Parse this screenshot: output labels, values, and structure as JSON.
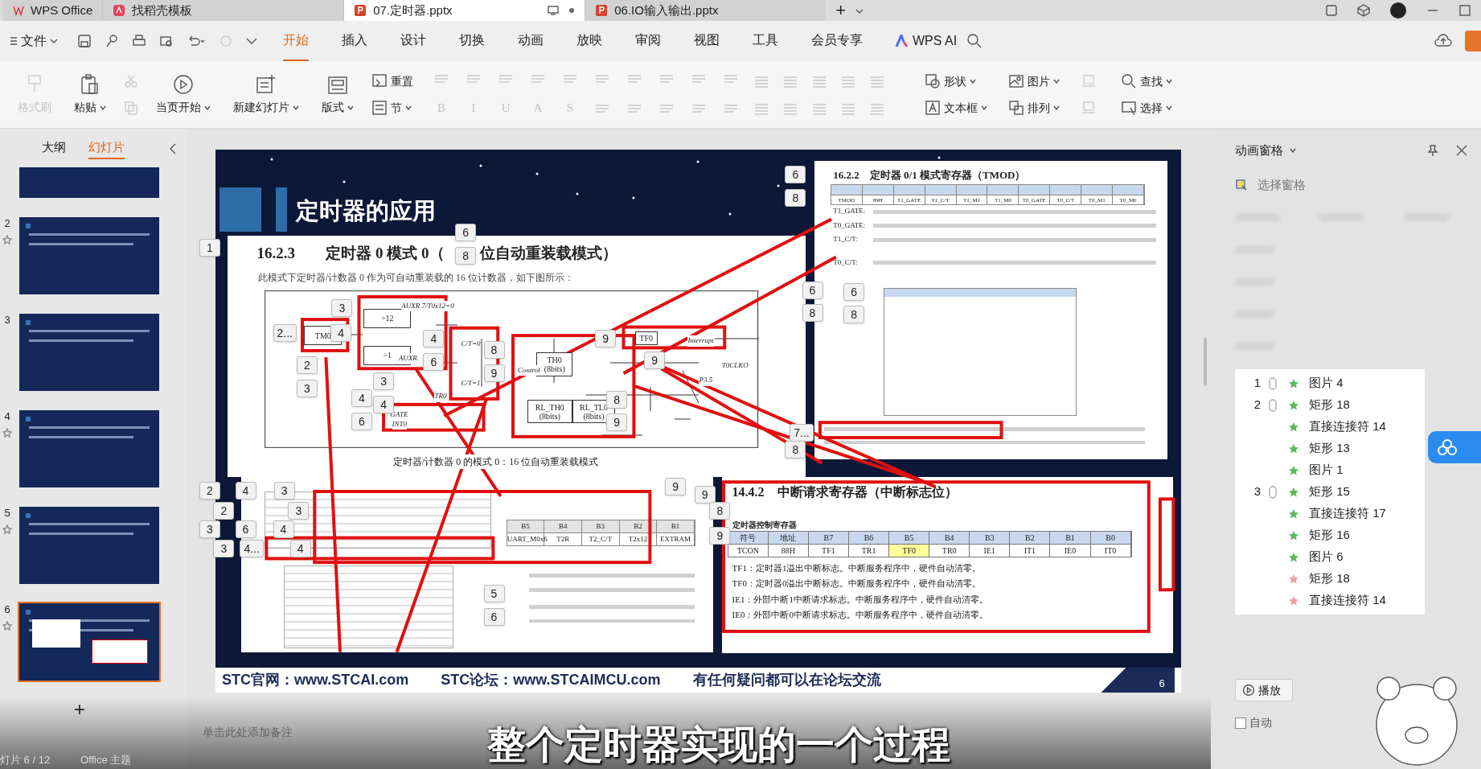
{
  "tabs": [
    {
      "label": "WPS Office",
      "kind": "home",
      "selected": false
    },
    {
      "label": "找稻壳模板",
      "kind": "template",
      "selected": false
    },
    {
      "label": "07.定时器.pptx",
      "kind": "doc",
      "selected": true
    },
    {
      "label": "06.IO输入输出.pptx",
      "kind": "doc",
      "selected": false
    }
  ],
  "new_tab": "+",
  "menu": {
    "file": "文件",
    "tabs": [
      {
        "label": "开始",
        "selected": true
      },
      {
        "label": "插入",
        "selected": false
      },
      {
        "label": "设计",
        "selected": false
      },
      {
        "label": "切换",
        "selected": false
      },
      {
        "label": "动画",
        "selected": false
      },
      {
        "label": "放映",
        "selected": false
      },
      {
        "label": "审阅",
        "selected": false
      },
      {
        "label": "视图",
        "selected": false
      },
      {
        "label": "工具",
        "selected": false
      },
      {
        "label": "会员专享",
        "selected": false
      }
    ],
    "ai": "WPS AI"
  },
  "ribbon": {
    "left": [
      {
        "label": "格式刷",
        "disabled": true
      },
      {
        "label": "粘贴",
        "disabled": false
      },
      {
        "label": "当页开始",
        "disabled": false
      },
      {
        "label": "新建幻灯片",
        "disabled": false
      },
      {
        "label": "版式",
        "disabled": false
      }
    ],
    "stack": [
      {
        "label": "重置"
      },
      {
        "label": "节"
      }
    ],
    "format": [
      "B",
      "I",
      "U",
      "A",
      "S"
    ],
    "right": [
      {
        "label": "形状"
      },
      {
        "label": "图片"
      },
      {
        "label": "查找"
      },
      {
        "label": "文本框"
      },
      {
        "label": "排列"
      },
      {
        "label": "选择"
      }
    ]
  },
  "side": {
    "tabs": [
      {
        "label": "大纲",
        "selected": false
      },
      {
        "label": "幻灯片",
        "selected": true
      }
    ],
    "slides": [
      {
        "animated": false,
        "selected": false
      },
      {
        "number": "2",
        "animated": true,
        "selected": false
      },
      {
        "number": "3",
        "animated": false,
        "selected": false
      },
      {
        "number": "4",
        "animated": true,
        "selected": false
      },
      {
        "number": "5",
        "animated": true,
        "selected": false
      },
      {
        "number": "6",
        "animated": true,
        "selected": true
      }
    ],
    "add": "+"
  },
  "slide": {
    "title": "定时器的应用",
    "doc1": {
      "heading": [
        "16.2.3",
        "定时器 0 模式 0（",
        "位自动重装载模式）"
      ],
      "intro": "此模式下定时器/计数器 0 作为可自动重装载的 16 位计数器，如下图所示：",
      "caption": "定时器/计数器 0 的模式 0：16 位自动重装载模式",
      "blocks": [
        "TM0",
        "÷12",
        "÷1",
        "TH0 (8bits)",
        "RL_TH0 (8bits)",
        "RL_TL0 (8bits)",
        "TF0"
      ],
      "labels": [
        "AUXR.7/T0x12=0",
        "AUXR.",
        "C/T=0",
        "C/T=1",
        "Interrupt",
        "T0CLKO",
        "P3.5",
        "TR0",
        "GATE",
        "INT0",
        "Control"
      ]
    },
    "doc2": {
      "heading": "16.2.2　定时器 0/1 模式寄存器（TMOD）",
      "row": [
        "TMOD",
        "89H",
        "T1_GATE",
        "T1_C/T",
        "T1_M1",
        "T1_M0",
        "T0_GATE",
        "T0_C/T",
        "T0_M1",
        "T0_M0"
      ],
      "fields": [
        "T1_GATE:",
        "T0_GATE:",
        "T1_C/T:",
        "T0_C/T:"
      ]
    },
    "doc3": {
      "heading": "14.4.2　中断请求寄存器（中断标志位）",
      "table_title": "定时器控制寄存器",
      "header": [
        "符号",
        "地址",
        "B7",
        "B6",
        "B5",
        "B4",
        "B3",
        "B2",
        "B1",
        "B0"
      ],
      "row": [
        "TCON",
        "88H",
        "TF1",
        "TR1",
        "TF0",
        "TR0",
        "IE1",
        "IT1",
        "IE0",
        "IT0"
      ],
      "notes": [
        "TF1：定时器1溢出中断标志。中断服务程序中，硬件自动清零。",
        "TF0：定时器0溢出中断标志。中断服务程序中，硬件自动清零。",
        "IE1：外部中断1中断请求标志。中断服务程序中，硬件自动清零。",
        "IE0：外部中断0中断请求标志。中断服务程序中，硬件自动清零。"
      ]
    },
    "doc4": {
      "header": [
        "B5",
        "B4",
        "B3",
        "B2",
        "B1"
      ],
      "row": [
        "UART_M0x6",
        "T2R",
        "T2_C/T",
        "T2x12",
        "EXTRAM"
      ]
    },
    "tags": [
      "1",
      "6",
      "8",
      "3",
      "2...",
      "4",
      "2",
      "3",
      "4",
      "6",
      "8",
      "9",
      "3",
      "4",
      "4",
      "6",
      "9",
      "9",
      "8",
      "9",
      "6",
      "8",
      "6",
      "8",
      "6",
      "8",
      "7...",
      "8",
      "9",
      "9",
      "8",
      "9",
      "5",
      "6",
      "2",
      "4",
      "3",
      "2",
      "3",
      "3",
      "6",
      "4",
      "3",
      "4...",
      "4"
    ],
    "footer": [
      "STC官网：www.STCAI.com",
      "STC论坛：www.STCAIMCU.com",
      "有任何疑问都可以在论坛交流"
    ],
    "page": "6"
  },
  "notes_placeholder": "单击此处添加备注",
  "subtitle": "整个定时器实现的一个过程",
  "status": {
    "slide_count": "灯片 6 / 12",
    "theme": "Office 主题"
  },
  "pane": {
    "title": "动画窗格",
    "select_pane": "选择窗格",
    "items": [
      {
        "number": "1",
        "color": "#5cb85c",
        "name": "图片 4"
      },
      {
        "number": "2",
        "color": "#5cb85c",
        "name": "矩形 18"
      },
      {
        "color": "#5cb85c",
        "name": "直接连接符 14"
      },
      {
        "color": "#5cb85c",
        "name": "矩形 13"
      },
      {
        "color": "#5cb85c",
        "name": "图片 1"
      },
      {
        "number": "3",
        "color": "#5cb85c",
        "name": "矩形 15"
      },
      {
        "color": "#5cb85c",
        "name": "直接连接符 17"
      },
      {
        "color": "#5cb85c",
        "name": "矩形 16"
      },
      {
        "color": "#5cb85c",
        "name": "图片 6"
      },
      {
        "color": "#f0a0a8",
        "name": "矩形 18"
      },
      {
        "color": "#f0a0a8",
        "name": "直接连接符 14"
      }
    ],
    "play": "播放",
    "auto_preview": "自动",
    "auto_preview_checked": false
  }
}
